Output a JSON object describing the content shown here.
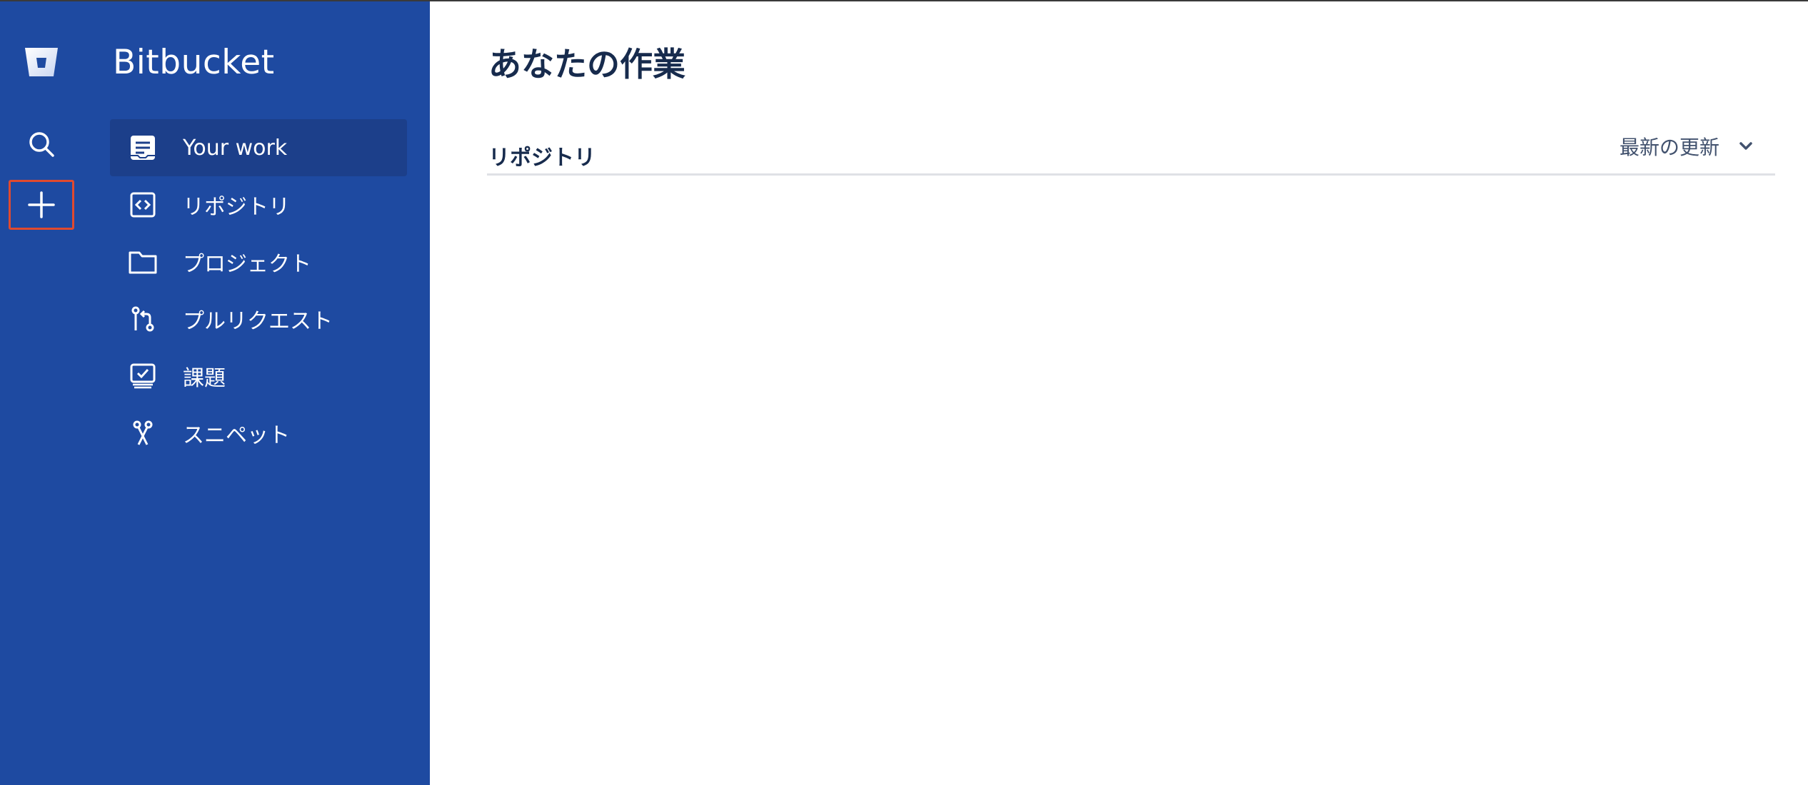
{
  "app": {
    "product_name": "Bitbucket"
  },
  "global_nav": {
    "logo_icon": "bitbucket-logo-icon",
    "search_icon": "search-icon",
    "create_icon": "plus-icon"
  },
  "sidebar": {
    "items": [
      {
        "label": "Your work",
        "icon": "your-work-icon",
        "active": true
      },
      {
        "label": "リポジトリ",
        "icon": "repository-icon",
        "active": false
      },
      {
        "label": "プロジェクト",
        "icon": "folder-icon",
        "active": false
      },
      {
        "label": "プルリクエスト",
        "icon": "pull-request-icon",
        "active": false
      },
      {
        "label": "課題",
        "icon": "issues-icon",
        "active": false
      },
      {
        "label": "スニペット",
        "icon": "snippet-icon",
        "active": false
      }
    ]
  },
  "main": {
    "title": "あなたの作業",
    "section": {
      "title": "リポジトリ",
      "sort_label": "最新の更新"
    }
  },
  "colors": {
    "sidebar_bg": "#1e4aa1",
    "active_item_bg": "#1c3f8a",
    "highlight_border": "#e04a2f",
    "text_dark": "#172b4d"
  }
}
